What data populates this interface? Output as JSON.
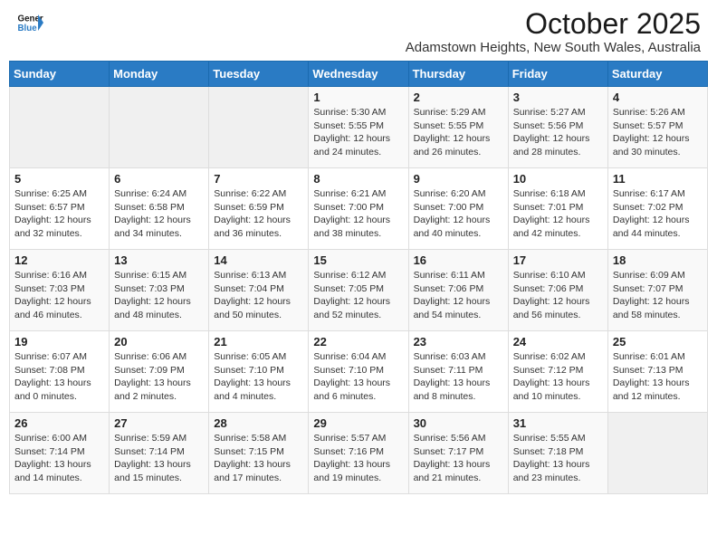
{
  "logo": {
    "line1": "General",
    "line2": "Blue"
  },
  "title": "October 2025",
  "location": "Adamstown Heights, New South Wales, Australia",
  "weekdays": [
    "Sunday",
    "Monday",
    "Tuesday",
    "Wednesday",
    "Thursday",
    "Friday",
    "Saturday"
  ],
  "weeks": [
    [
      {
        "day": "",
        "info": ""
      },
      {
        "day": "",
        "info": ""
      },
      {
        "day": "",
        "info": ""
      },
      {
        "day": "1",
        "info": "Sunrise: 5:30 AM\nSunset: 5:55 PM\nDaylight: 12 hours\nand 24 minutes."
      },
      {
        "day": "2",
        "info": "Sunrise: 5:29 AM\nSunset: 5:55 PM\nDaylight: 12 hours\nand 26 minutes."
      },
      {
        "day": "3",
        "info": "Sunrise: 5:27 AM\nSunset: 5:56 PM\nDaylight: 12 hours\nand 28 minutes."
      },
      {
        "day": "4",
        "info": "Sunrise: 5:26 AM\nSunset: 5:57 PM\nDaylight: 12 hours\nand 30 minutes."
      }
    ],
    [
      {
        "day": "5",
        "info": "Sunrise: 6:25 AM\nSunset: 6:57 PM\nDaylight: 12 hours\nand 32 minutes."
      },
      {
        "day": "6",
        "info": "Sunrise: 6:24 AM\nSunset: 6:58 PM\nDaylight: 12 hours\nand 34 minutes."
      },
      {
        "day": "7",
        "info": "Sunrise: 6:22 AM\nSunset: 6:59 PM\nDaylight: 12 hours\nand 36 minutes."
      },
      {
        "day": "8",
        "info": "Sunrise: 6:21 AM\nSunset: 7:00 PM\nDaylight: 12 hours\nand 38 minutes."
      },
      {
        "day": "9",
        "info": "Sunrise: 6:20 AM\nSunset: 7:00 PM\nDaylight: 12 hours\nand 40 minutes."
      },
      {
        "day": "10",
        "info": "Sunrise: 6:18 AM\nSunset: 7:01 PM\nDaylight: 12 hours\nand 42 minutes."
      },
      {
        "day": "11",
        "info": "Sunrise: 6:17 AM\nSunset: 7:02 PM\nDaylight: 12 hours\nand 44 minutes."
      }
    ],
    [
      {
        "day": "12",
        "info": "Sunrise: 6:16 AM\nSunset: 7:03 PM\nDaylight: 12 hours\nand 46 minutes."
      },
      {
        "day": "13",
        "info": "Sunrise: 6:15 AM\nSunset: 7:03 PM\nDaylight: 12 hours\nand 48 minutes."
      },
      {
        "day": "14",
        "info": "Sunrise: 6:13 AM\nSunset: 7:04 PM\nDaylight: 12 hours\nand 50 minutes."
      },
      {
        "day": "15",
        "info": "Sunrise: 6:12 AM\nSunset: 7:05 PM\nDaylight: 12 hours\nand 52 minutes."
      },
      {
        "day": "16",
        "info": "Sunrise: 6:11 AM\nSunset: 7:06 PM\nDaylight: 12 hours\nand 54 minutes."
      },
      {
        "day": "17",
        "info": "Sunrise: 6:10 AM\nSunset: 7:06 PM\nDaylight: 12 hours\nand 56 minutes."
      },
      {
        "day": "18",
        "info": "Sunrise: 6:09 AM\nSunset: 7:07 PM\nDaylight: 12 hours\nand 58 minutes."
      }
    ],
    [
      {
        "day": "19",
        "info": "Sunrise: 6:07 AM\nSunset: 7:08 PM\nDaylight: 13 hours\nand 0 minutes."
      },
      {
        "day": "20",
        "info": "Sunrise: 6:06 AM\nSunset: 7:09 PM\nDaylight: 13 hours\nand 2 minutes."
      },
      {
        "day": "21",
        "info": "Sunrise: 6:05 AM\nSunset: 7:10 PM\nDaylight: 13 hours\nand 4 minutes."
      },
      {
        "day": "22",
        "info": "Sunrise: 6:04 AM\nSunset: 7:10 PM\nDaylight: 13 hours\nand 6 minutes."
      },
      {
        "day": "23",
        "info": "Sunrise: 6:03 AM\nSunset: 7:11 PM\nDaylight: 13 hours\nand 8 minutes."
      },
      {
        "day": "24",
        "info": "Sunrise: 6:02 AM\nSunset: 7:12 PM\nDaylight: 13 hours\nand 10 minutes."
      },
      {
        "day": "25",
        "info": "Sunrise: 6:01 AM\nSunset: 7:13 PM\nDaylight: 13 hours\nand 12 minutes."
      }
    ],
    [
      {
        "day": "26",
        "info": "Sunrise: 6:00 AM\nSunset: 7:14 PM\nDaylight: 13 hours\nand 14 minutes."
      },
      {
        "day": "27",
        "info": "Sunrise: 5:59 AM\nSunset: 7:14 PM\nDaylight: 13 hours\nand 15 minutes."
      },
      {
        "day": "28",
        "info": "Sunrise: 5:58 AM\nSunset: 7:15 PM\nDaylight: 13 hours\nand 17 minutes."
      },
      {
        "day": "29",
        "info": "Sunrise: 5:57 AM\nSunset: 7:16 PM\nDaylight: 13 hours\nand 19 minutes."
      },
      {
        "day": "30",
        "info": "Sunrise: 5:56 AM\nSunset: 7:17 PM\nDaylight: 13 hours\nand 21 minutes."
      },
      {
        "day": "31",
        "info": "Sunrise: 5:55 AM\nSunset: 7:18 PM\nDaylight: 13 hours\nand 23 minutes."
      },
      {
        "day": "",
        "info": ""
      }
    ]
  ]
}
